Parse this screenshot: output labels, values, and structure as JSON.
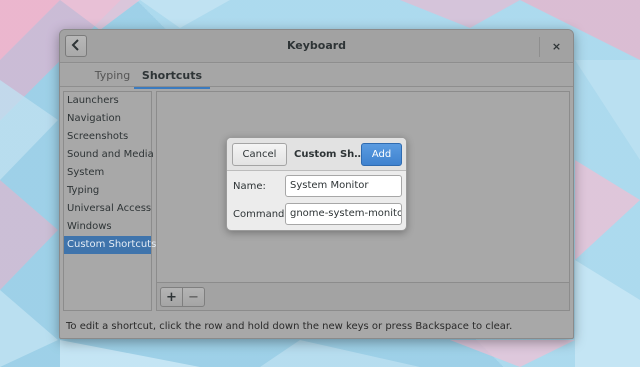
{
  "window": {
    "title": "Keyboard",
    "close_label": "×"
  },
  "tabs": [
    {
      "label": "Typing",
      "active": false
    },
    {
      "label": "Shortcuts",
      "active": true
    }
  ],
  "sidebar": {
    "items": [
      {
        "label": "Launchers"
      },
      {
        "label": "Navigation"
      },
      {
        "label": "Screenshots"
      },
      {
        "label": "Sound and Media"
      },
      {
        "label": "System"
      },
      {
        "label": "Typing"
      },
      {
        "label": "Universal Access"
      },
      {
        "label": "Windows"
      },
      {
        "label": "Custom Shortcuts"
      }
    ],
    "selected_index": 8
  },
  "toolbar": {
    "add_label": "+",
    "remove_label": "−"
  },
  "hint": "To edit a shortcut, click the row and hold down the new keys or press Backspace to clear.",
  "dialog": {
    "cancel_label": "Cancel",
    "title": "Custom Sh…",
    "add_label": "Add",
    "name_label": "Name:",
    "name_value": "System Monitor",
    "command_label": "Command:",
    "command_value": "gnome-system-monito"
  },
  "colors": {
    "accent": "#3f74ac",
    "add_button": "#4a8bd6"
  }
}
